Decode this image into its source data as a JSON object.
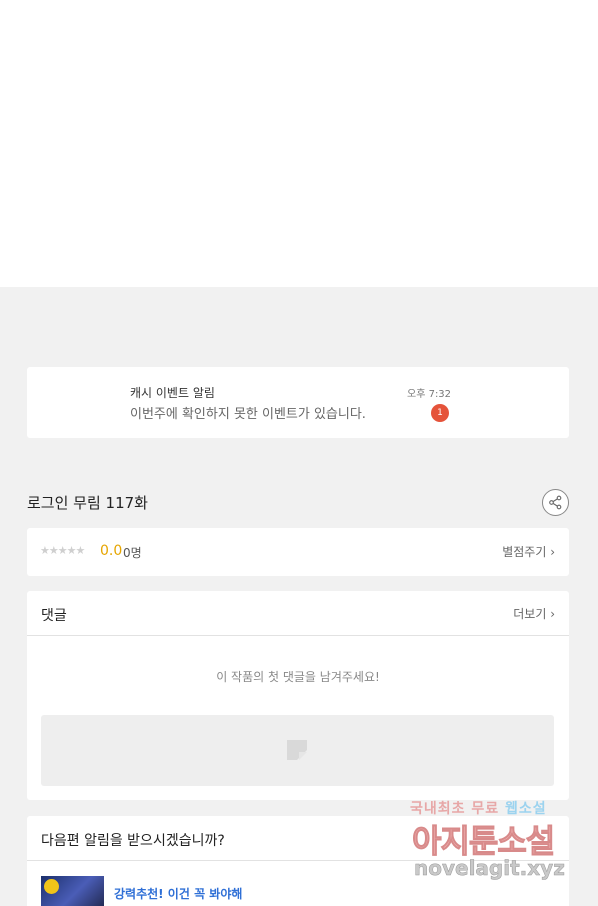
{
  "notification": {
    "title": "캐시 이벤트 알림",
    "body": "이번주에 확인하지 못한 이벤트가 있습니다.",
    "time": "오후 7:32",
    "badge_count": "1"
  },
  "episode": {
    "title": "로그인 무림 117화",
    "share_icon": "share-icon"
  },
  "rating": {
    "stars": "★★★★★",
    "score": "0.0",
    "count": "0명",
    "rate_label": "별점주기 ›"
  },
  "comments": {
    "title": "댓글",
    "more_label": "더보기 ›",
    "empty_message": "이 작품의 첫 댓글을 남겨주세요!"
  },
  "next_episode": {
    "title": "다음편 알림을 받으시겠습니까?",
    "recommend_text": "강력추천! 이건 꼭 봐야해"
  },
  "watermark": {
    "line1_a": "국내최초 무료 ",
    "line1_b": "웹소설",
    "line2": "아지툰소설",
    "line3": "novelagit.xyz"
  },
  "colors": {
    "accent_orange": "#e6a500",
    "badge_red": "#e5533a",
    "link_blue": "#2f6fd6"
  }
}
